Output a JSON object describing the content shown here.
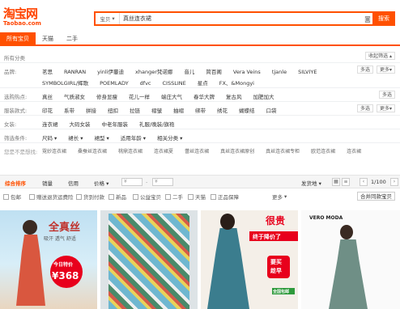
{
  "header": {
    "logo_cn": "淘宝网",
    "logo_en": "Taobao.com",
    "search_scope": "宝贝",
    "search_query": "真丝连衣裙",
    "search_button": "搜索"
  },
  "tabs": [
    "所有宝贝",
    "天猫",
    "二手"
  ],
  "filters": {
    "top_label": "所有分类",
    "collapse_label": "收起筛选",
    "brand": {
      "label": "品牌:",
      "values": [
        "茗思",
        "RANRAN",
        "yinli伊蔓迪",
        "xhanger梵诺娜",
        "音儿",
        "简百阁",
        "Vera Veins",
        "tjanle",
        "SILVIYE",
        "SYMBOLGIRL/辉歌",
        "POEMLADY",
        "dfvc",
        "CISSLINE",
        "星点",
        "FX、&Mongyi"
      ]
    },
    "hot": {
      "label": "选购热点:",
      "values": [
        "真丝",
        "气质淑女",
        "修身显瘦",
        "花儿一样",
        "端庄大气",
        "春华大牌",
        "复古风",
        "加肥加大"
      ]
    },
    "style": {
      "label": "服装款式:",
      "values": [
        "印花",
        "系带",
        "拼接",
        "纽扣",
        "拉链",
        "褶皱",
        "抽褶",
        "绑带",
        "绣花",
        "蝴蝶结",
        "口袋"
      ]
    },
    "women": {
      "label": "女装:",
      "values": [
        "连衣裙",
        "大码女装",
        "中老年服装",
        "礼服/晚装/旗袍"
      ]
    },
    "conditions": {
      "label": "筛选条件:",
      "values": [
        "尺码",
        "裙长",
        "裙型",
        "适用年龄",
        "相关分类"
      ]
    },
    "related": {
      "label": "您是不是想找:",
      "values": [
        "霓妙连衣裙",
        "桑蚕丝连衣裙",
        "桃鼎连衣裙",
        "连衣裙夏",
        "蕾丝连衣裙",
        "真丝连衣裙原创",
        "真丝连衣裙专柜",
        "欧范连衣裙",
        "连衣裙"
      ]
    },
    "multi": "多选",
    "more": "更多"
  },
  "sort": {
    "items": [
      "综合排序",
      "销量",
      "信用",
      "价格"
    ],
    "price_from": "¥",
    "price_to": "¥",
    "ship_from": "发货地",
    "page": "1/100"
  },
  "options": {
    "items": [
      "包邮",
      "赠送退货运费险",
      "货到付款",
      "新品",
      "公益宝贝",
      "二手",
      "天猫",
      "正品保障"
    ],
    "more": "更多",
    "group_button": "合并同款宝贝"
  },
  "products": [
    {
      "tag1": "全真丝",
      "tag2": "吸汗 透气 舒适",
      "tag3": "今日特价",
      "price": "368"
    },
    {},
    {
      "tag1": "很贵",
      "tag2": "终于降价了",
      "tag3": "要买",
      "tag4": "趁早",
      "tag5": "全国包邮"
    },
    {
      "brand": "VERO MODA"
    }
  ],
  "colors": {
    "accent": "#ff5000",
    "price_red": "#e8001c"
  }
}
